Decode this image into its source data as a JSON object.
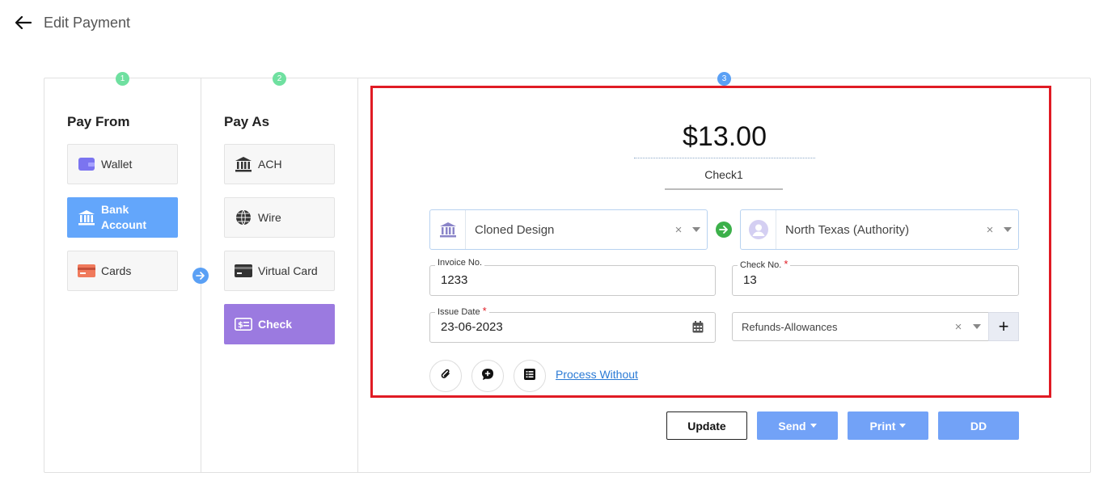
{
  "header": {
    "title": "Edit Payment",
    "back_icon": "arrow-left-icon"
  },
  "steps": [
    "1",
    "2",
    "3"
  ],
  "pay_from": {
    "title": "Pay From",
    "options": [
      {
        "label": "Wallet",
        "icon": "wallet-icon"
      },
      {
        "label": "Bank Account",
        "icon": "bank-icon",
        "selected": true
      },
      {
        "label": "Cards",
        "icon": "card-icon"
      }
    ]
  },
  "pay_as": {
    "title": "Pay As",
    "options": [
      {
        "label": "ACH",
        "icon": "bank-icon"
      },
      {
        "label": "Wire",
        "icon": "globe-icon"
      },
      {
        "label": "Virtual Card",
        "icon": "virtual-card-icon"
      },
      {
        "label": "Check",
        "icon": "check-icon",
        "selected": true
      }
    ]
  },
  "payment": {
    "amount": "$13.00",
    "check_name": "Check1",
    "from_party": "Cloned Design",
    "to_party": "North Texas (Authority)",
    "invoice_label": "Invoice No.",
    "invoice_value": "1233",
    "check_no_label": "Check No.",
    "check_no_value": "13",
    "issue_date_label": "Issue Date",
    "issue_date_value": "23-06-2023",
    "category_value": "Refunds-Allowances",
    "process_link": "Process Without",
    "required_mark": "*",
    "clear_mark": "×",
    "plus_mark": "+"
  },
  "actions": {
    "update": "Update",
    "send": "Send",
    "print": "Print",
    "dd": "DD"
  },
  "colors": {
    "highlight_border": "#e01b24",
    "selected_from": "#63a6fb",
    "selected_as": "#9b7ae0",
    "action_fill": "#72a2f7",
    "link": "#2a7ad5"
  }
}
